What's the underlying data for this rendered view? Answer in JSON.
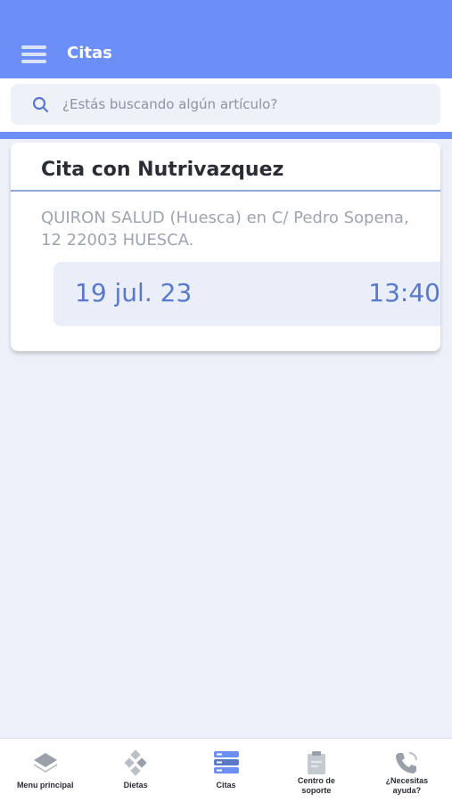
{
  "header": {
    "title": "Citas",
    "menu_icon": "hamburger-menu-icon",
    "background_color": "#6b8ff7"
  },
  "search": {
    "placeholder": "¿Estás buscando algún artículo?",
    "icon": "search-icon"
  },
  "appointment": {
    "title": "Cita con Nutrivazquez",
    "address": "QUIRON SALUD (Huesca) en C/ Pedro Sopena, 12 22003 HUESCA.",
    "date": "19 jul. 23",
    "time": "13:40",
    "accent_color": "#5a79c9"
  },
  "bottom_nav": {
    "items": [
      {
        "label": "Menu principal",
        "icon": "layers-icon",
        "active": false
      },
      {
        "label": "Dietas",
        "icon": "diamond-grid-icon",
        "active": false
      },
      {
        "label": "Citas",
        "icon": "server-stack-icon",
        "active": true
      },
      {
        "label": "Centro de soporte",
        "icon": "clipboard-icon",
        "active": false
      },
      {
        "label": "¿Necesitas ayuda?",
        "icon": "phone-icon",
        "active": false
      }
    ]
  }
}
